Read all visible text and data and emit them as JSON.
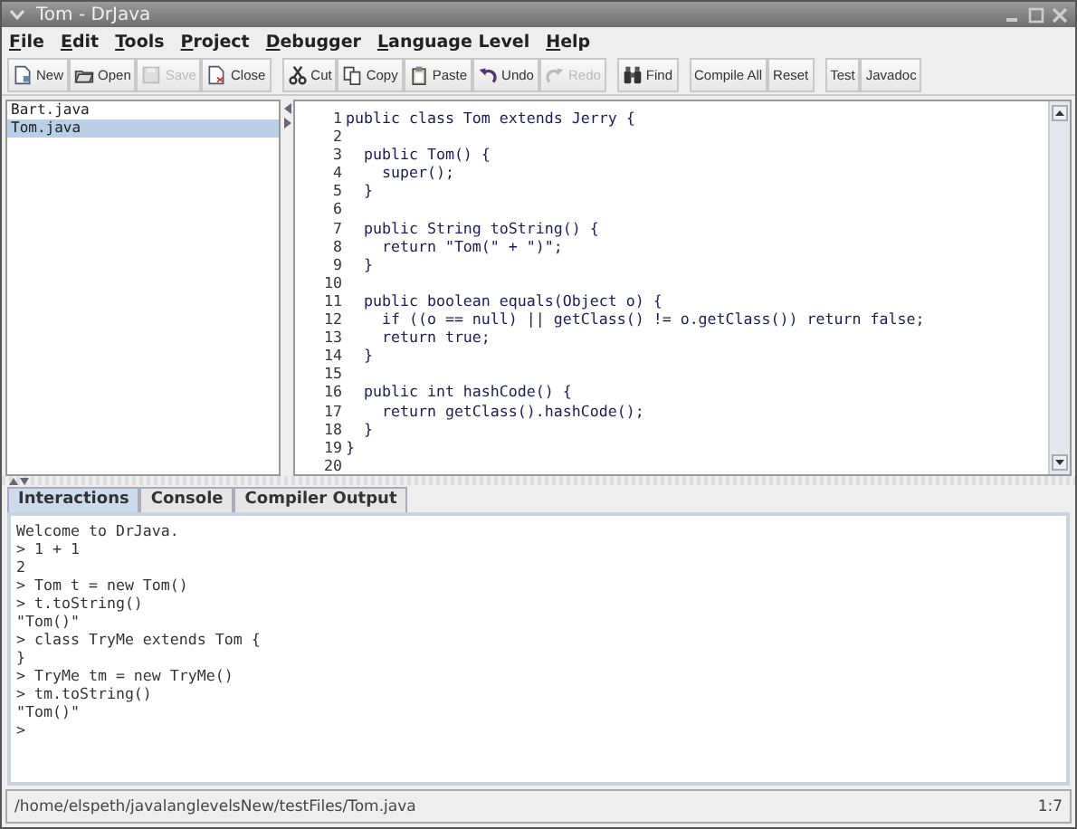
{
  "window": {
    "title": "Tom - DrJava"
  },
  "menu": [
    "File",
    "Edit",
    "Tools",
    "Project",
    "Debugger",
    "Language Level",
    "Help"
  ],
  "toolbar": {
    "groups": [
      {
        "buttons": [
          {
            "label": "New",
            "disabled": false
          },
          {
            "label": "Open",
            "disabled": false
          },
          {
            "label": "Save",
            "disabled": true
          },
          {
            "label": "Close",
            "disabled": false
          }
        ]
      },
      {
        "buttons": [
          {
            "label": "Cut",
            "disabled": false
          },
          {
            "label": "Copy",
            "disabled": false
          },
          {
            "label": "Paste",
            "disabled": false
          },
          {
            "label": "Undo",
            "disabled": false
          },
          {
            "label": "Redo",
            "disabled": true
          }
        ]
      },
      {
        "buttons": [
          {
            "label": "Find",
            "disabled": false
          }
        ]
      },
      {
        "buttons": [
          {
            "label": "Compile All",
            "disabled": false
          },
          {
            "label": "Reset",
            "disabled": false
          }
        ]
      },
      {
        "buttons": [
          {
            "label": "Test",
            "disabled": false
          },
          {
            "label": "Javadoc",
            "disabled": false
          }
        ]
      }
    ]
  },
  "files": [
    {
      "name": "Bart.java",
      "selected": false
    },
    {
      "name": "Tom.java",
      "selected": true
    }
  ],
  "editor": {
    "lines": [
      {
        "number": "1",
        "code": "public class Tom extends Jerry {"
      },
      {
        "number": "2"
      },
      {
        "number": "3",
        "code": "  public Tom() {"
      },
      {
        "number": "4",
        "code": "    super();"
      },
      {
        "number": "5",
        "code": "  }"
      },
      {
        "number": "6"
      },
      {
        "number": "7",
        "code": "  public String toString() {"
      },
      {
        "number": "8",
        "code": "    return \"Tom(\" + \")\";"
      },
      {
        "number": "9",
        "code": "  }"
      },
      {
        "number": "10"
      },
      {
        "number": "11",
        "code": "  public boolean equals(Object o) {"
      },
      {
        "number": "12",
        "code": "    if ((o == null) || getClass() != o.getClass()) return false;"
      },
      {
        "number": "13",
        "code": "    return true;"
      },
      {
        "number": "14",
        "code": "  }"
      },
      {
        "number": "15"
      },
      {
        "number": "16",
        "code": "  public int hashCode() {"
      },
      {
        "number": "17",
        "code": "    return getClass().hashCode();"
      },
      {
        "number": "18",
        "code": "  }"
      },
      {
        "number": "19",
        "code": "}"
      },
      {
        "number": "20"
      }
    ]
  },
  "tabs": [
    {
      "label": "Interactions",
      "selected": true
    },
    {
      "label": "Console",
      "selected": false
    },
    {
      "label": "Compiler Output",
      "selected": false
    }
  ],
  "interactions": [
    "Welcome to DrJava.",
    "> 1 + 1",
    "2",
    "> Tom t = new Tom()",
    "> t.toString()",
    "\"Tom()\"",
    "> class TryMe extends Tom {",
    "}",
    "> TryMe tm = new TryMe()",
    "> tm.toString()",
    "\"Tom()\"",
    ">"
  ],
  "status_bar": {
    "path": "/home/elspeth/javalanglevelsNew/testFiles/Tom.java",
    "position": "1:7"
  }
}
